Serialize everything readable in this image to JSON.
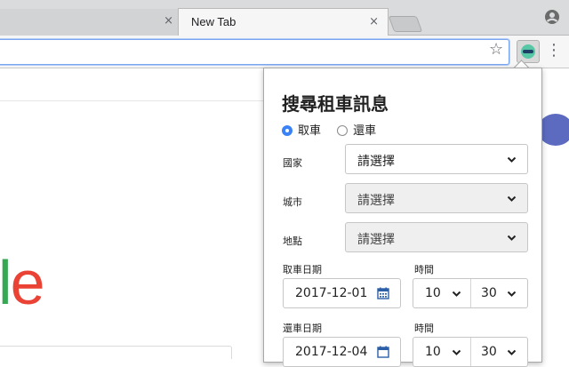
{
  "browser": {
    "tabs": [
      {
        "label": "",
        "close": "×"
      },
      {
        "label": "New Tab",
        "close": "×"
      }
    ],
    "star_icon": "☆",
    "menu_icon": "⋮"
  },
  "page": {
    "google_partial_l": "l",
    "google_partial_e": "e"
  },
  "popup": {
    "title": "搜尋租車訊息",
    "radio": [
      {
        "label": "取車",
        "checked": true
      },
      {
        "label": "還車",
        "checked": false
      }
    ],
    "country": {
      "label": "國家",
      "value": "請選擇"
    },
    "city": {
      "label": "城市",
      "value": "請選擇"
    },
    "location": {
      "label": "地點",
      "value": "請選擇"
    },
    "pickup": {
      "date_label": "取車日期",
      "date": "2017-12-01",
      "time_label": "時間",
      "hour": "10",
      "minute": "30"
    },
    "return": {
      "date_label": "還車日期",
      "date": "2017-12-04",
      "time_label": "時間",
      "hour": "10",
      "minute": "30"
    }
  },
  "colors": {
    "accent": "#3b82f6",
    "calendar": "#2b5fa8",
    "google_green": "#34a853",
    "google_red": "#ea4335"
  }
}
